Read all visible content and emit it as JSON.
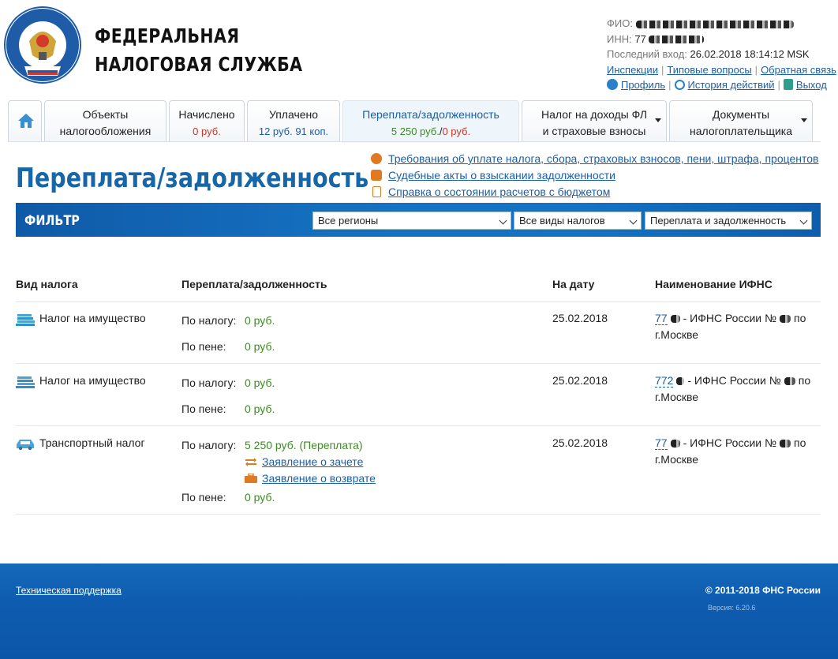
{
  "brand": {
    "line1": "ФЕДЕРАЛЬНАЯ",
    "line2": "НАЛОГОВАЯ СЛУЖБА",
    "logo_icon": "fns-emblem-icon"
  },
  "user": {
    "fio_label": "ФИО:",
    "inn_label": "ИНН:",
    "inn_prefix": "77",
    "last_login_label": "Последний вход:",
    "last_login_value": "26.02.2018 18:14:12 MSK",
    "links": [
      "Инспекции",
      "Типовые вопросы",
      "Обратная связь"
    ],
    "profile": "Профиль",
    "history": "История действий",
    "logout": "Выход"
  },
  "tabs": [
    {
      "title": "Объекты",
      "title2": "налогообложения"
    },
    {
      "title": "Начислено",
      "sub": "0 руб."
    },
    {
      "title": "Уплачено",
      "sub": "12 руб. 91 коп."
    },
    {
      "title": "Переплата/задолженность",
      "sub_a": "5 250 руб.",
      "sub_sep": "/",
      "sub_b": "0 руб."
    },
    {
      "title": "Налог на доходы ФЛ",
      "title2": "и страховые взносы"
    },
    {
      "title": "Документы",
      "title2": "налогоплательщика"
    }
  ],
  "page_title": "Переплата/задолженность",
  "quick_links": [
    "Требования об уплате налога, сбора, страховых взносов, пени, штрафа, процентов",
    "Судебные акты о взыскании задолженности",
    "Справка о состоянии расчетов с бюджетом"
  ],
  "filter": {
    "label": "ФИЛЬТР",
    "region": "Все регионы",
    "tax_type": "Все виды налогов",
    "balance": "Переплата и задолженность"
  },
  "table": {
    "headers": [
      "Вид налога",
      "Переплата/задолженность",
      "На дату",
      "Наименование ИФНС"
    ],
    "tax_label": "По налогу:",
    "fine_label": "По пене:",
    "rows": [
      {
        "name": "Налог на имущество",
        "tax": "0 руб.",
        "fine": "0 руб.",
        "date": "25.02.2018",
        "ifns_code": "77",
        "ifns_name": "- ИФНС России №",
        "ifns_suffix": "по",
        "ifns_city": "г.Москве"
      },
      {
        "name": "Налог на имущество",
        "tax": "0 руб.",
        "fine": "0 руб.",
        "date": "25.02.2018",
        "ifns_code": "772",
        "ifns_name": "- ИФНС России №",
        "ifns_suffix": "по",
        "ifns_city": "г.Москве"
      },
      {
        "name": "Транспортный налог",
        "tax": "5 250 руб. (Переплата)",
        "fine": "0 руб.",
        "date": "25.02.2018",
        "ifns_code": "77",
        "ifns_name": "- ИФНС России №",
        "ifns_suffix": "по",
        "ifns_city": "г.Москве",
        "actions": [
          "Заявление о зачете",
          "Заявление о возврате"
        ]
      }
    ]
  },
  "footer": {
    "support": "Техническая поддержка",
    "copyright": "© 2011-2018 ФНС России",
    "version": "Версия: 6.20.6"
  },
  "colors": {
    "brand_blue": "#1766a8",
    "link": "#1a5fa8",
    "green": "#3a8d1e",
    "red": "#c0392b",
    "footer": "#0e5cb0"
  }
}
